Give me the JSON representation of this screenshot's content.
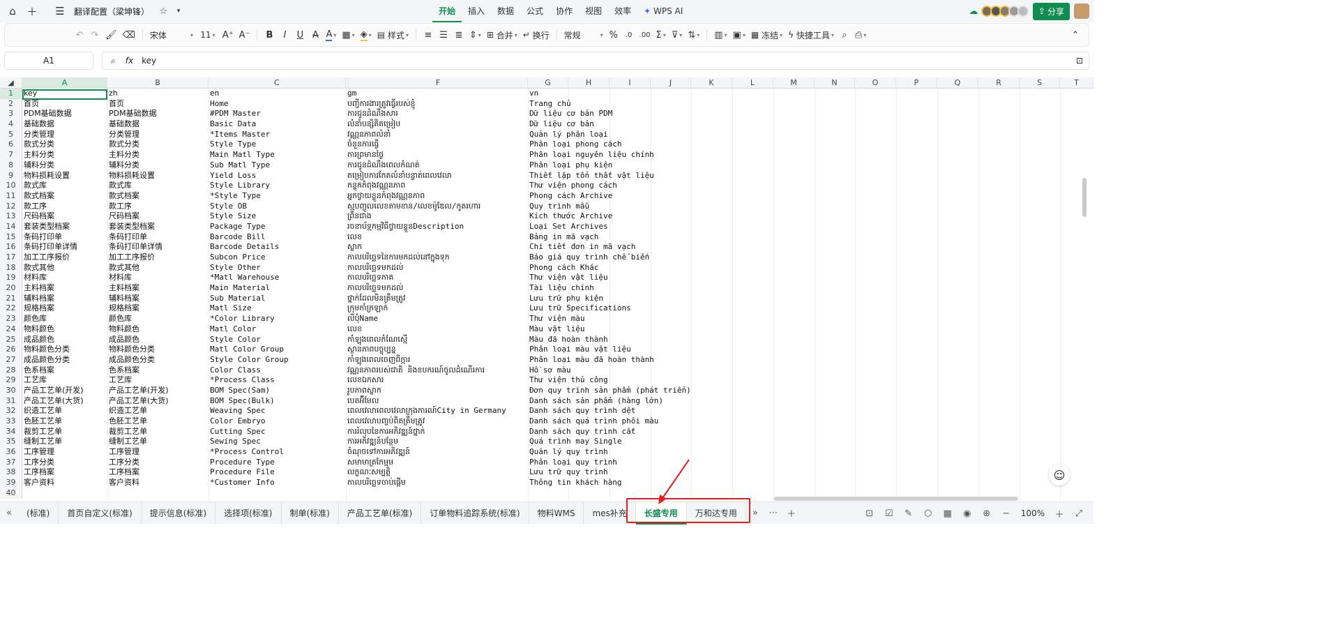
{
  "titlebar": {
    "doc_title": "翻译配置（梁坤锋）",
    "menu": [
      "开始",
      "插入",
      "数据",
      "公式",
      "协作",
      "视图",
      "效率",
      "WPS AI"
    ],
    "active_menu": "开始",
    "share": "分享"
  },
  "toolbar": {
    "font": "宋体",
    "size": "11",
    "style_label": "样式",
    "merge_label": "合并",
    "wrap_label": "换行",
    "format_label": "常规",
    "freeze_label": "冻结",
    "tools_label": "快捷工具"
  },
  "formula": {
    "cell_ref": "A1",
    "fx": "fx",
    "value": "key"
  },
  "columns": [
    "A",
    "B",
    "C",
    "",
    "F",
    "G",
    "H",
    "I",
    "J",
    "K",
    "L",
    "M",
    "N",
    "O",
    "P",
    "Q",
    "R",
    "S",
    "T"
  ],
  "rows": [
    [
      "key",
      "zh",
      "en",
      "gm",
      "vn"
    ],
    [
      "首页",
      "首页",
      "Home",
      "បញ្ជីការងារត្រូវធ្វើរបស់ខ្ញុំ",
      "Trang chủ"
    ],
    [
      "PDM基础数据",
      "PDM基础数据",
      "#PDM Master",
      "ការជូនដំណឹងសារ",
      "Dữ liệu cơ bản PDM"
    ],
    [
      "基础数据",
      "基础数据",
      "Basic Data",
      "លំនាំបន្សិតិតម្រៀប",
      "Dữ liệu cơ bản"
    ],
    [
      "分类管理",
      "分类管理",
      "*Items Master",
      "វណ្ណនភាពលំនាំ",
      "Quản lý phân loại"
    ],
    [
      "款式分类",
      "款式分类",
      "Style Type",
      "ចំនួនការធ្វើ",
      "Phân loại phong cách"
    ],
    [
      "主料分类",
      "主料分类",
      "Main Matl Type",
      "ការព្រមានថ្ងៃ",
      "Phân loại nguyên liệu chính"
    ],
    [
      "辅料分类",
      "辅料分类",
      "Sub Matl Type",
      "ការជូនដំណឹងពេលកំណត់",
      "Phân loại phụ kiện"
    ],
    [
      "物料损耗设置",
      "物料损耗设置",
      "Yield Loss",
      "តម្រៀបការកែតលំនាំបន្ទាត់ពេលវេលា",
      "Thiết lập tổn thất vật liệu"
    ],
    [
      "款式库",
      "款式库",
      "Style Library",
      "កន្ទុកកំពុងវណ្ណនភាព",
      "Thư viện phong cách"
    ],
    [
      "款式档案",
      "款式档案",
      "*Style Type",
      "អ្នកថ្វាយខ្លួនកំពុងវណ្ណនភាព",
      "Phong cách Archive"
    ],
    [
      "款工序",
      "款工序",
      "Style OB",
      "ស្មបញ្ចូលលេខតាមខាន/លេខម៉ូឌែល/កូតរហារ",
      "Quy trình mẫu"
    ],
    [
      "尺码档案",
      "尺码档案",
      "Style Size",
      "ព្រឹនជាង",
      "Kích thước Archive"
    ],
    [
      "套装类型档案",
      "套装类型档案",
      "Package Type",
      "រចនាប័ទ្មកម្មវិធីថ្វាយខ្លួនDescription",
      "Loại Set Archives"
    ],
    [
      "条码打印单",
      "条码打印单",
      "Barcode Bill",
      "លេខ",
      "Bảng in mã vạch"
    ],
    [
      "条码打印单详情",
      "条码打印单详情",
      "Barcode Details",
      "ស្លាក",
      "Chi tiết đơn in mã vạch"
    ],
    [
      "加工工序报价",
      "加工工序报价",
      "Subcon Price",
      "កាលបរិច្ឆេទនៃការមកដល់នៅក្នុងទុក",
      "Báo giá quy trình chế biến"
    ],
    [
      "款式其他",
      "款式其他",
      "Style Other",
      "កាលបរិច្ឆេទមកដល់",
      "Phong cách Khác"
    ],
    [
      "材料库",
      "材料库",
      "*Matl Warehouse",
      "កាលបរិច្ឆេទភាគ",
      "Thư viện vật liệu"
    ],
    [
      "主料档案",
      "主料档案",
      "Main Material",
      "កាលបរិច្ឆេទមកដល់",
      "Tài liệu chính"
    ],
    [
      "辅料档案",
      "辅料档案",
      "Sub Material",
      "ថ្នាក់ដែលមិនត្រឹមត្រូវ",
      "Lưu trữ phụ kiện"
    ],
    [
      "规格档案",
      "规格档案",
      "Matl Size",
      "ក្រុមកាំក្រឡាក់",
      "Lưu trữ Specifications"
    ],
    [
      "颜色库",
      "颜色库",
      "*Color Library",
      "លីបុំName",
      "Thư viện màu"
    ],
    [
      "物料颜色",
      "物料颜色",
      "Matl Color",
      "លេខ",
      "Màu vật liệu"
    ],
    [
      "成品颜色",
      "成品颜色",
      "Style Color",
      "កាំឡុងពេលកំណែស្មើ",
      "Màu đã hoàn thành"
    ],
    [
      "物料颜色分类",
      "物料颜色分类",
      "Matl Color Group",
      "ស្ថានភាពបច្ចុប្បន្ន",
      "Phân loại màu vật liệu"
    ],
    [
      "成品颜色分类",
      "成品颜色分类",
      "Style Color Group",
      "កាំឡុងពេលចេញពីក្ការ",
      "Phân loại màu đã hoàn thành"
    ],
    [
      "色系档案",
      "色系档案",
      "Color Class",
      "វណ្ណនភាពរបស់ជាតិ និងខបករណ៍ចូលដំណើរការ",
      "Hồ sơ màu"
    ],
    [
      "工艺库",
      "工艺库",
      "*Process Class",
      "លេខឯកសារ",
      "Thư viện thủ công"
    ],
    [
      "产品工艺单(开发)",
      "产品工艺单(开发)",
      "BOM Spec(Sam)",
      "រូបភាពស្លាក",
      "Đơn quy trình sản phẩm (phát triển)"
    ],
    [
      "产品工艺单(大货)",
      "产品工艺单(大货)",
      "BOM Spec(Bulk)",
      "បេតអ៊ីមែល",
      "Danh sách sản phẩm (hàng lớn)"
    ],
    [
      "织造工艺单",
      "织造工艺单",
      "Weaving Spec",
      "ពេលវេលាពេលវេលាក្រុងការណ៍City in Germany",
      "Danh sách quy trình dệt"
    ],
    [
      "色胚工艺单",
      "色胚工艺单",
      "Color Embryo",
      "ពេលវេលាបញ្ចប់ពិតត្រឹមត្រូវ",
      "Danh sách quá trình phôi màu"
    ],
    [
      "裁剪工艺单",
      "裁剪工艺单",
      "Cutting Spec",
      "ការរំលុបនៃការអភិវឌ្ឍន៍ថ្នាក់",
      "Danh sách quy trình cắt"
    ],
    [
      "缝制工艺单",
      "缝制工艺单",
      "Sewing Spec",
      "ការអភិវឌ្ឍន៍បន្ថែម",
      "Quá trình may Single"
    ],
    [
      "工序管理",
      "工序管理",
      "*Process Control",
      "ចំណុចទៅការអភិវឌ្ឍន៍",
      "Quản lý quy trình"
    ],
    [
      "工序分类",
      "工序分类",
      "Procedure Type",
      "សមាមាត្រកែម្មម",
      "Phân loại quy trình"
    ],
    [
      "工序档案",
      "工序档案",
      "Procedure File",
      "លក្ខណៈសម្បត្តិ",
      "Lưu trữ quy trình"
    ],
    [
      "客户资料",
      "客户资料",
      "*Customer Info",
      "កាលបរិច្ឆេទចាប់ផ្ដើម",
      "Thông tin khách hàng"
    ],
    [
      "",
      "",
      "",
      "",
      ""
    ]
  ],
  "sheets": [
    "(标准)",
    "首页自定义(标准)",
    "提示信息(标准)",
    "选择项(标准)",
    "制单(标准)",
    "产品工艺单(标准)",
    "订单物料追踪系统(标准)",
    "物料WMS",
    "mes补充",
    "长盛专用",
    "万和达专用"
  ],
  "active_sheet": "长盛专用",
  "zoom": "100%",
  "colors": {
    "accent": "#0f8c50",
    "annotation": "#e02020"
  }
}
